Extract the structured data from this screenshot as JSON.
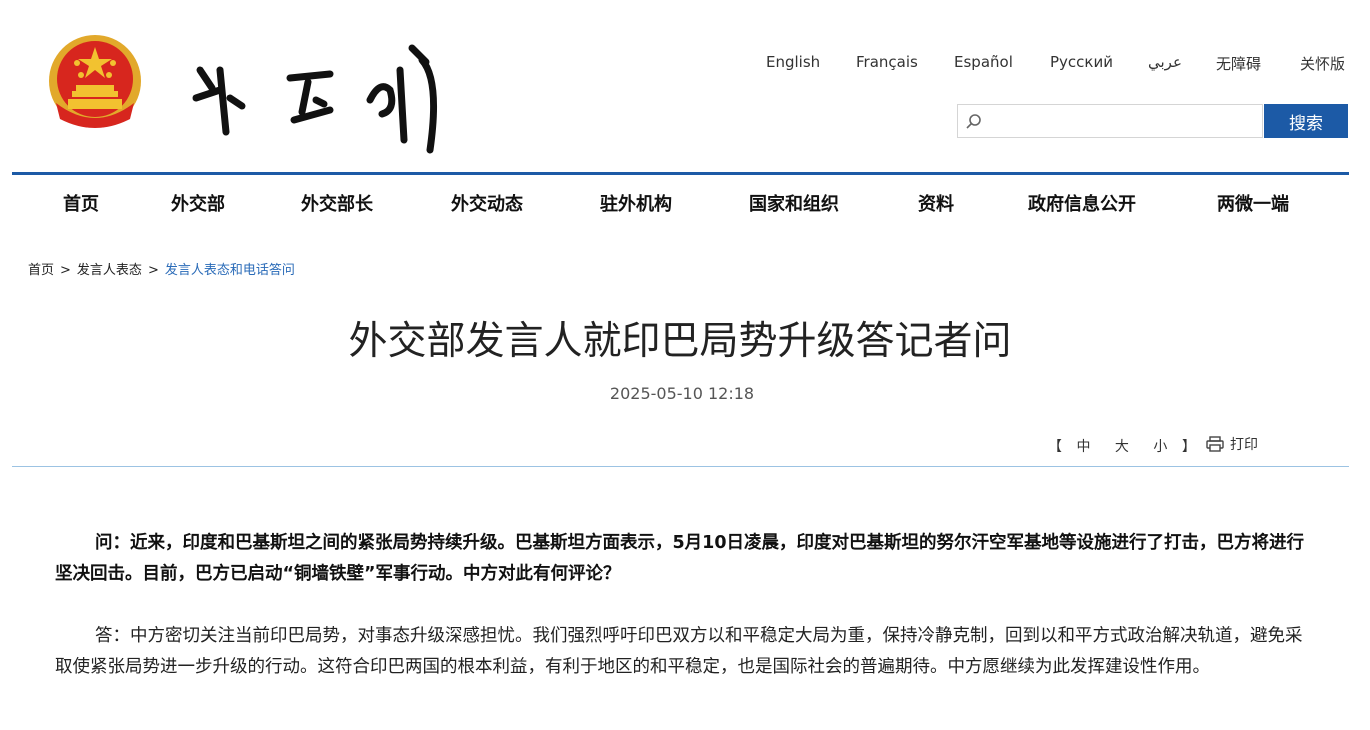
{
  "header": {
    "logo_text": "外交部",
    "languages": [
      "English",
      "Français",
      "Español",
      "Русский",
      "عربي",
      "无障碍",
      "关怀版"
    ],
    "search": {
      "placeholder": "",
      "button_label": "搜索"
    }
  },
  "nav": {
    "items": [
      "首页",
      "外交部",
      "外交部长",
      "外交动态",
      "驻外机构",
      "国家和组织",
      "资料",
      "政府信息公开",
      "两微一端"
    ]
  },
  "breadcrumb": {
    "items": [
      "首页",
      "发言人表态",
      "发言人表态和电话答问"
    ],
    "separator": ">"
  },
  "article": {
    "title": "外交部发言人就印巴局势升级答记者问",
    "date": "2025-05-10 12:18",
    "font_size": {
      "open": "【",
      "sizes": [
        "中",
        "大",
        "小"
      ],
      "close": "】"
    },
    "print_label": "打印",
    "question": "问：近来，印度和巴基斯坦之间的紧张局势持续升级。巴基斯坦方面表示，5月10日凌晨，印度对巴基斯坦的努尔汗空军基地等设施进行了打击，巴方将进行坚决回击。目前，巴方已启动“铜墙铁壁”军事行动。中方对此有何评论？",
    "answer": "答：中方密切关注当前印巴局势，对事态升级深感担忧。我们强烈呼吁印巴双方以和平稳定大局为重，保持冷静克制，回到以和平方式政治解决轨道，避免采取使紧张局势进一步升级的行动。这符合印巴两国的根本利益，有利于地区的和平稳定，也是国际社会的普遍期待。中方愿继续为此发挥建设性作用。"
  },
  "colors": {
    "accent": "#1c5aa6",
    "link": "#2a6bb8",
    "emblem_red": "#d7261e",
    "emblem_gold": "#f2c230"
  }
}
